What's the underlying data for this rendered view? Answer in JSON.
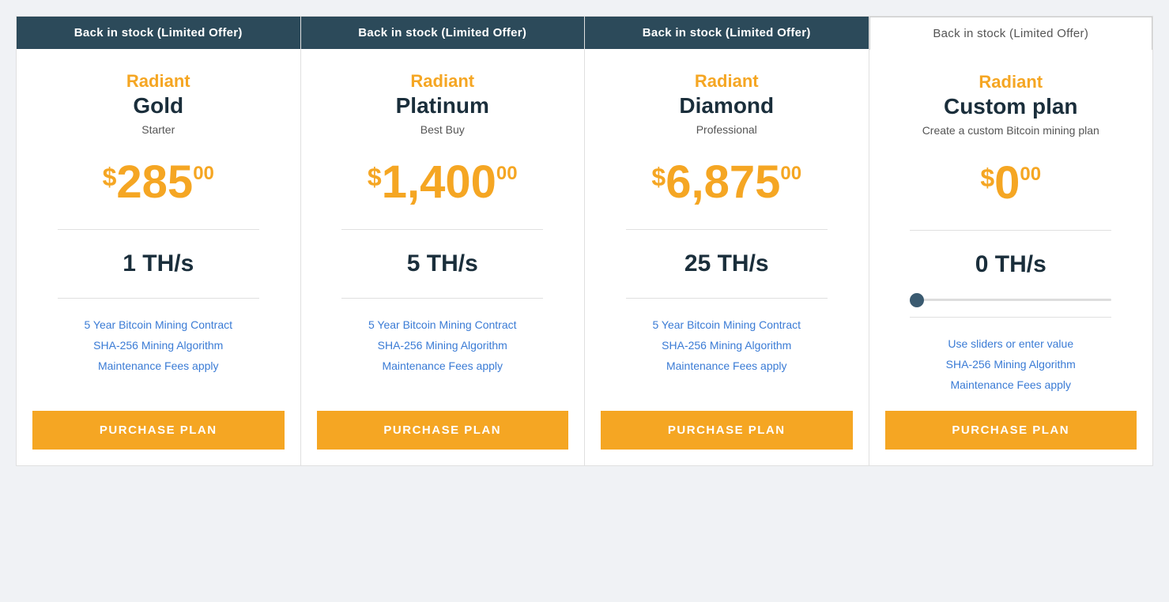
{
  "cards": [
    {
      "id": "gold",
      "banner": "Back in stock (Limited Offer)",
      "banner_highlighted": true,
      "brand": "Radiant",
      "plan": "Gold",
      "subtitle": "Starter",
      "price_dollar": "$",
      "price_main": "285",
      "price_cents": "00",
      "hashrate": "1 TH/s",
      "features": [
        "5 Year Bitcoin Mining Contract",
        "SHA-256 Mining Algorithm",
        "Maintenance Fees apply"
      ],
      "button_label": "PURCHASE PLAN"
    },
    {
      "id": "platinum",
      "banner": "Back in stock (Limited Offer)",
      "banner_highlighted": true,
      "brand": "Radiant",
      "plan": "Platinum",
      "subtitle": "Best Buy",
      "price_dollar": "$",
      "price_main": "1,400",
      "price_cents": "00",
      "hashrate": "5 TH/s",
      "features": [
        "5 Year Bitcoin Mining Contract",
        "SHA-256 Mining Algorithm",
        "Maintenance Fees apply"
      ],
      "button_label": "PURCHASE PLAN"
    },
    {
      "id": "diamond",
      "banner": "Back in stock (Limited Offer)",
      "banner_highlighted": true,
      "brand": "Radiant",
      "plan": "Diamond",
      "subtitle": "Professional",
      "price_dollar": "$",
      "price_main": "6,875",
      "price_cents": "00",
      "hashrate": "25 TH/s",
      "features": [
        "5 Year Bitcoin Mining Contract",
        "SHA-256 Mining Algorithm",
        "Maintenance Fees apply"
      ],
      "button_label": "PURCHASE PLAN"
    },
    {
      "id": "custom",
      "banner": "Back in stock (Limited Offer)",
      "banner_highlighted": false,
      "brand": "Radiant",
      "plan": "Custom plan",
      "subtitle": "Create a custom Bitcoin mining plan",
      "price_dollar": "$",
      "price_main": "0",
      "price_cents": "00",
      "hashrate": "0 TH/s",
      "use_slider": true,
      "slider_label": "Use sliders or enter value",
      "features": [
        "SHA-256 Mining Algorithm",
        "Maintenance Fees apply"
      ],
      "button_label": "PURCHASE PLAN"
    }
  ]
}
